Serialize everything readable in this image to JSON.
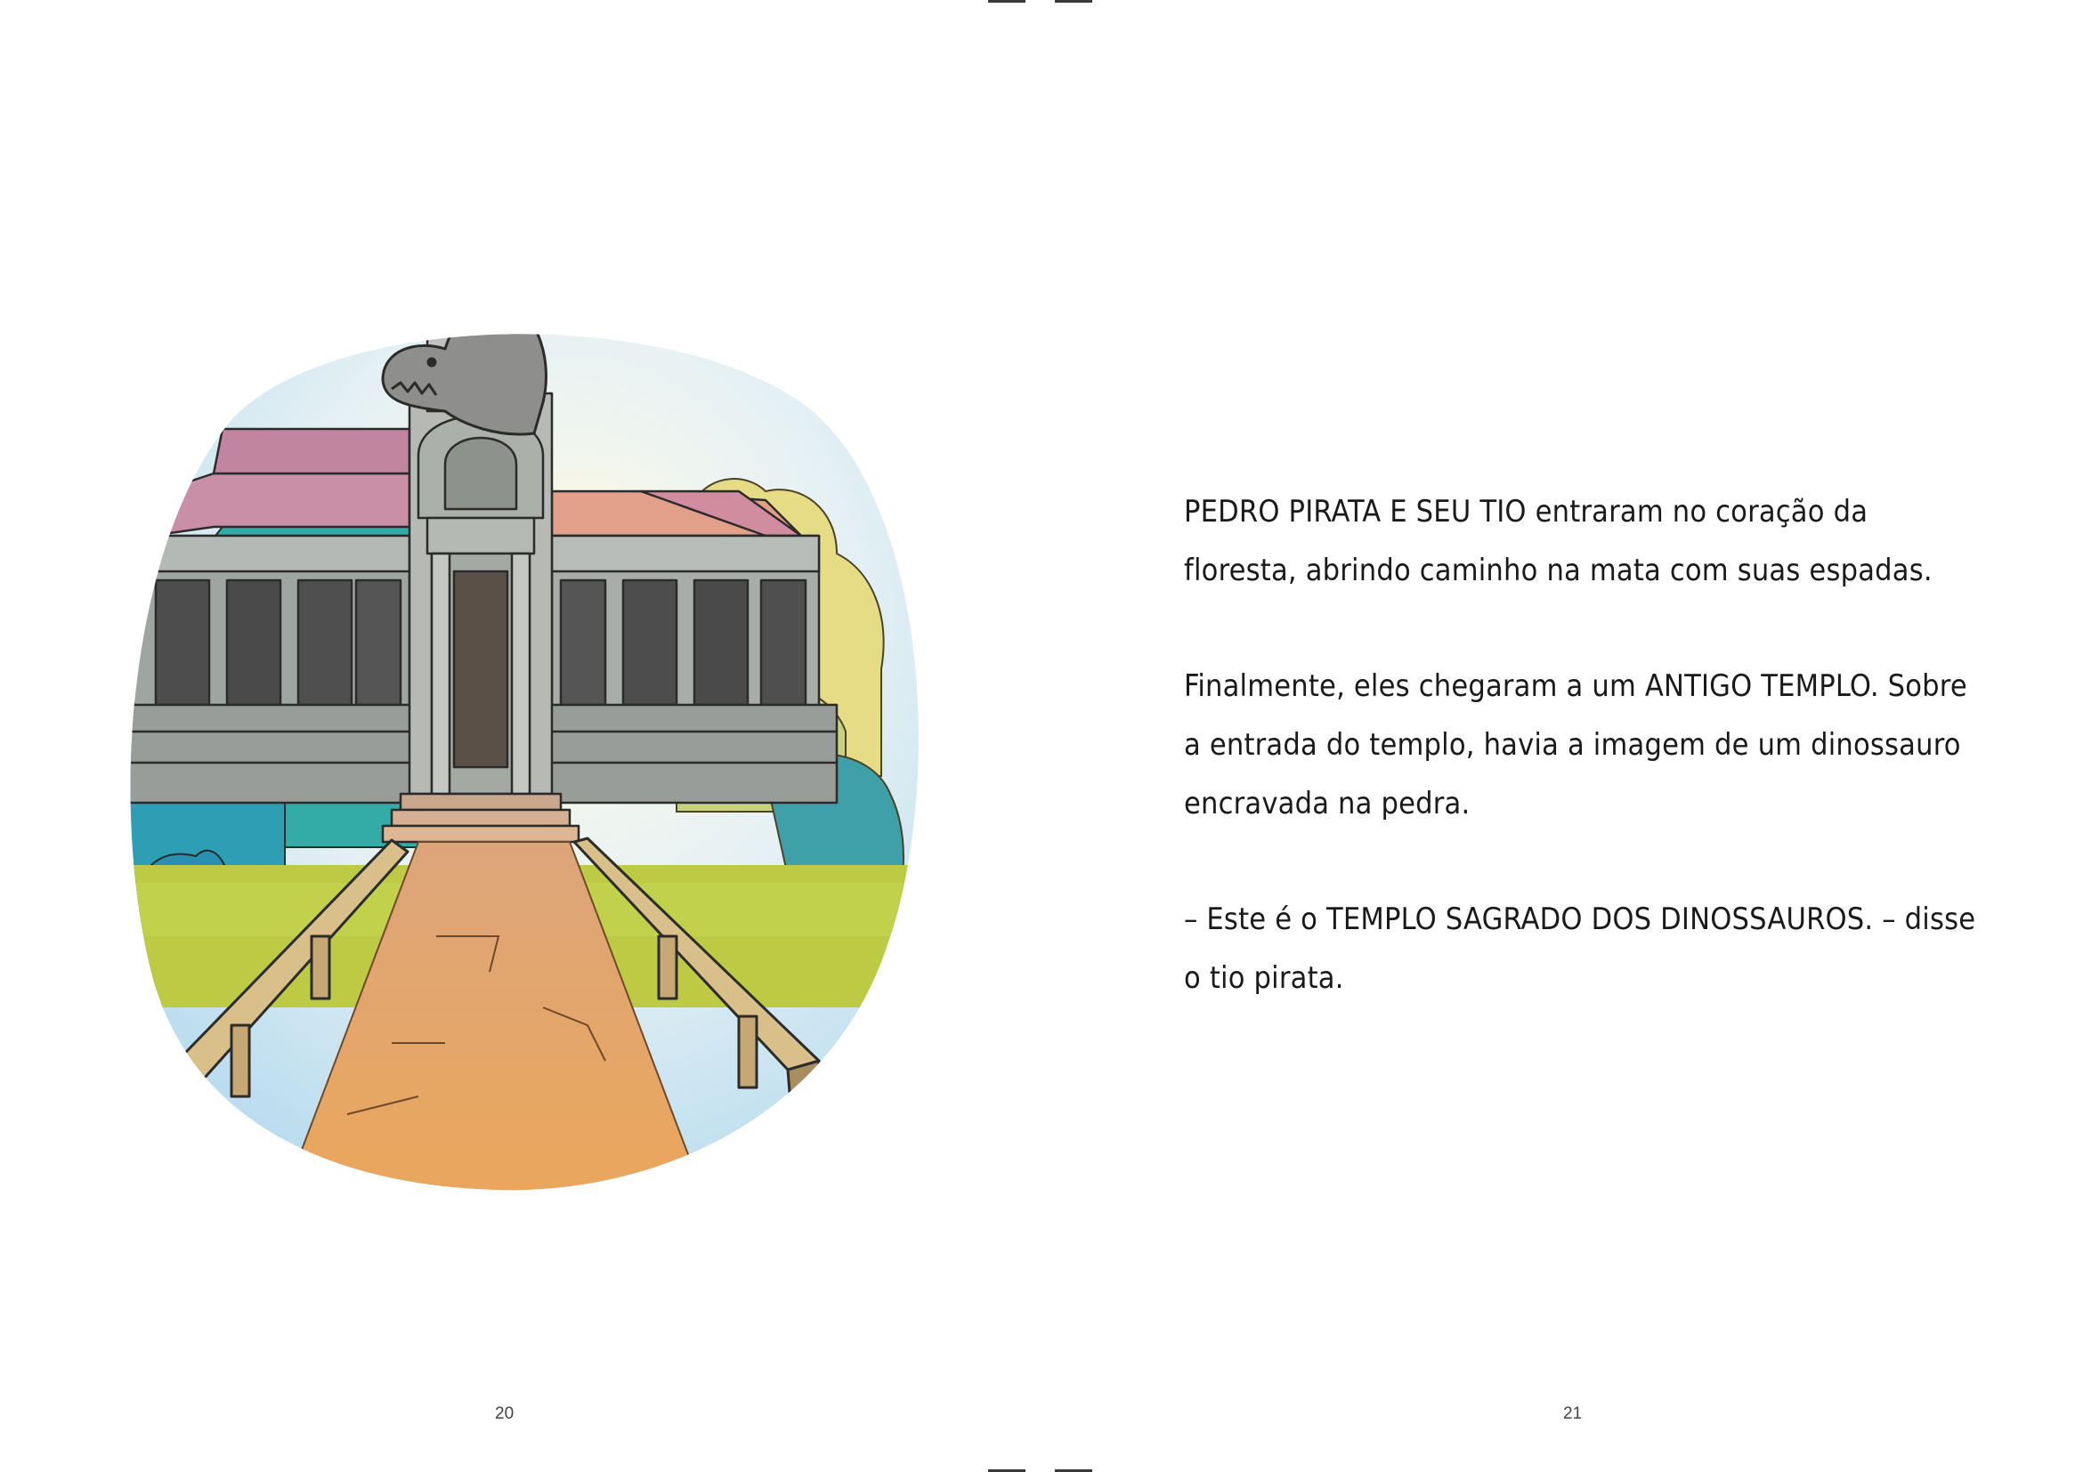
{
  "paragraphs": [
    "PEDRO PIRATA E SEU TIO entraram no coração da floresta, abrindo caminho na mata com suas espadas.",
    "Finalmente, eles chegaram a um ANTIGO TEMPLO. Sobre a entrada do templo, havia a imagem de um dinossauro encravada na pedra.",
    "– Este é o TEMPLO SAGRADO DOS DINOSSAUROS. – disse o tio pirata."
  ],
  "page_numbers": {
    "left": "20",
    "right": "21"
  },
  "colors": {
    "sky": "#cfe6f2",
    "trees_left": "#2fa7a2",
    "trees_right": "#e5d77a",
    "roof": "#c98aa3",
    "roof_right": "#e9a37a",
    "stone": "#a5a8a3",
    "grass": "#b9c94a",
    "path": "#e8a866"
  }
}
